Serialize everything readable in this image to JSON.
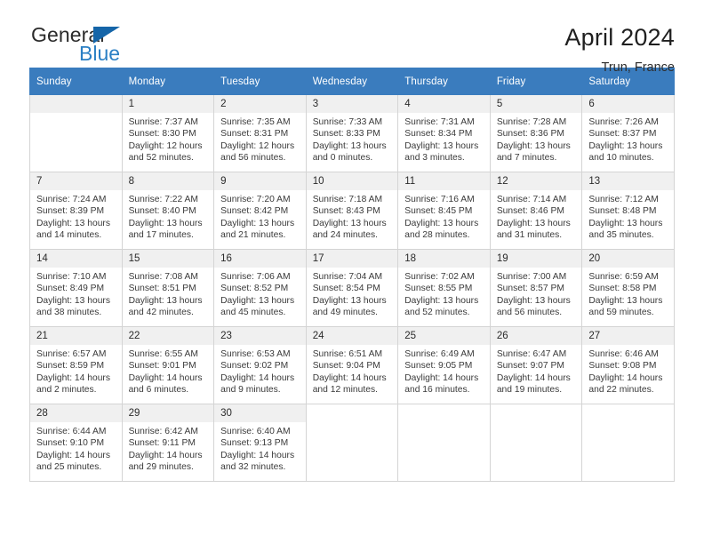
{
  "brand": {
    "name_top": "General",
    "name_bottom": "Blue",
    "triangle_color": "#1565a8",
    "blue_color": "#2a7fc4"
  },
  "header": {
    "title": "April 2024",
    "subtitle": "Trun, France"
  },
  "theme": {
    "header_row_bg": "#3a7cbe",
    "daynum_bg": "#f0f0f0",
    "grid_border": "#d4d4d4"
  },
  "calendar": {
    "weekdays": [
      "Sunday",
      "Monday",
      "Tuesday",
      "Wednesday",
      "Thursday",
      "Friday",
      "Saturday"
    ],
    "weeks": [
      [
        {
          "day": "",
          "lines": []
        },
        {
          "day": "1",
          "lines": [
            "Sunrise: 7:37 AM",
            "Sunset: 8:30 PM",
            "Daylight: 12 hours",
            "and 52 minutes."
          ]
        },
        {
          "day": "2",
          "lines": [
            "Sunrise: 7:35 AM",
            "Sunset: 8:31 PM",
            "Daylight: 12 hours",
            "and 56 minutes."
          ]
        },
        {
          "day": "3",
          "lines": [
            "Sunrise: 7:33 AM",
            "Sunset: 8:33 PM",
            "Daylight: 13 hours",
            "and 0 minutes."
          ]
        },
        {
          "day": "4",
          "lines": [
            "Sunrise: 7:31 AM",
            "Sunset: 8:34 PM",
            "Daylight: 13 hours",
            "and 3 minutes."
          ]
        },
        {
          "day": "5",
          "lines": [
            "Sunrise: 7:28 AM",
            "Sunset: 8:36 PM",
            "Daylight: 13 hours",
            "and 7 minutes."
          ]
        },
        {
          "day": "6",
          "lines": [
            "Sunrise: 7:26 AM",
            "Sunset: 8:37 PM",
            "Daylight: 13 hours",
            "and 10 minutes."
          ]
        }
      ],
      [
        {
          "day": "7",
          "lines": [
            "Sunrise: 7:24 AM",
            "Sunset: 8:39 PM",
            "Daylight: 13 hours",
            "and 14 minutes."
          ]
        },
        {
          "day": "8",
          "lines": [
            "Sunrise: 7:22 AM",
            "Sunset: 8:40 PM",
            "Daylight: 13 hours",
            "and 17 minutes."
          ]
        },
        {
          "day": "9",
          "lines": [
            "Sunrise: 7:20 AM",
            "Sunset: 8:42 PM",
            "Daylight: 13 hours",
            "and 21 minutes."
          ]
        },
        {
          "day": "10",
          "lines": [
            "Sunrise: 7:18 AM",
            "Sunset: 8:43 PM",
            "Daylight: 13 hours",
            "and 24 minutes."
          ]
        },
        {
          "day": "11",
          "lines": [
            "Sunrise: 7:16 AM",
            "Sunset: 8:45 PM",
            "Daylight: 13 hours",
            "and 28 minutes."
          ]
        },
        {
          "day": "12",
          "lines": [
            "Sunrise: 7:14 AM",
            "Sunset: 8:46 PM",
            "Daylight: 13 hours",
            "and 31 minutes."
          ]
        },
        {
          "day": "13",
          "lines": [
            "Sunrise: 7:12 AM",
            "Sunset: 8:48 PM",
            "Daylight: 13 hours",
            "and 35 minutes."
          ]
        }
      ],
      [
        {
          "day": "14",
          "lines": [
            "Sunrise: 7:10 AM",
            "Sunset: 8:49 PM",
            "Daylight: 13 hours",
            "and 38 minutes."
          ]
        },
        {
          "day": "15",
          "lines": [
            "Sunrise: 7:08 AM",
            "Sunset: 8:51 PM",
            "Daylight: 13 hours",
            "and 42 minutes."
          ]
        },
        {
          "day": "16",
          "lines": [
            "Sunrise: 7:06 AM",
            "Sunset: 8:52 PM",
            "Daylight: 13 hours",
            "and 45 minutes."
          ]
        },
        {
          "day": "17",
          "lines": [
            "Sunrise: 7:04 AM",
            "Sunset: 8:54 PM",
            "Daylight: 13 hours",
            "and 49 minutes."
          ]
        },
        {
          "day": "18",
          "lines": [
            "Sunrise: 7:02 AM",
            "Sunset: 8:55 PM",
            "Daylight: 13 hours",
            "and 52 minutes."
          ]
        },
        {
          "day": "19",
          "lines": [
            "Sunrise: 7:00 AM",
            "Sunset: 8:57 PM",
            "Daylight: 13 hours",
            "and 56 minutes."
          ]
        },
        {
          "day": "20",
          "lines": [
            "Sunrise: 6:59 AM",
            "Sunset: 8:58 PM",
            "Daylight: 13 hours",
            "and 59 minutes."
          ]
        }
      ],
      [
        {
          "day": "21",
          "lines": [
            "Sunrise: 6:57 AM",
            "Sunset: 8:59 PM",
            "Daylight: 14 hours",
            "and 2 minutes."
          ]
        },
        {
          "day": "22",
          "lines": [
            "Sunrise: 6:55 AM",
            "Sunset: 9:01 PM",
            "Daylight: 14 hours",
            "and 6 minutes."
          ]
        },
        {
          "day": "23",
          "lines": [
            "Sunrise: 6:53 AM",
            "Sunset: 9:02 PM",
            "Daylight: 14 hours",
            "and 9 minutes."
          ]
        },
        {
          "day": "24",
          "lines": [
            "Sunrise: 6:51 AM",
            "Sunset: 9:04 PM",
            "Daylight: 14 hours",
            "and 12 minutes."
          ]
        },
        {
          "day": "25",
          "lines": [
            "Sunrise: 6:49 AM",
            "Sunset: 9:05 PM",
            "Daylight: 14 hours",
            "and 16 minutes."
          ]
        },
        {
          "day": "26",
          "lines": [
            "Sunrise: 6:47 AM",
            "Sunset: 9:07 PM",
            "Daylight: 14 hours",
            "and 19 minutes."
          ]
        },
        {
          "day": "27",
          "lines": [
            "Sunrise: 6:46 AM",
            "Sunset: 9:08 PM",
            "Daylight: 14 hours",
            "and 22 minutes."
          ]
        }
      ],
      [
        {
          "day": "28",
          "lines": [
            "Sunrise: 6:44 AM",
            "Sunset: 9:10 PM",
            "Daylight: 14 hours",
            "and 25 minutes."
          ]
        },
        {
          "day": "29",
          "lines": [
            "Sunrise: 6:42 AM",
            "Sunset: 9:11 PM",
            "Daylight: 14 hours",
            "and 29 minutes."
          ]
        },
        {
          "day": "30",
          "lines": [
            "Sunrise: 6:40 AM",
            "Sunset: 9:13 PM",
            "Daylight: 14 hours",
            "and 32 minutes."
          ]
        },
        {
          "day": "",
          "lines": []
        },
        {
          "day": "",
          "lines": []
        },
        {
          "day": "",
          "lines": []
        },
        {
          "day": "",
          "lines": []
        }
      ]
    ]
  }
}
